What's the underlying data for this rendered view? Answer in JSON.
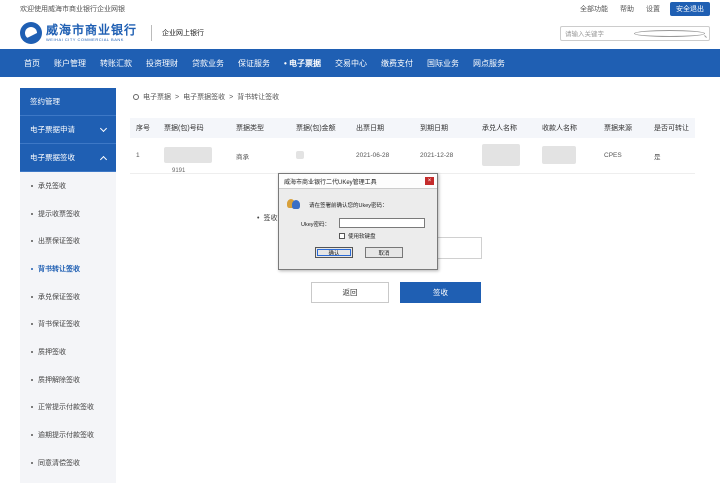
{
  "topbar": {
    "welcome": "欢迎使用威海市商业银行企业网银",
    "links": [
      "全部功能",
      "帮助",
      "设置"
    ],
    "exit_label": "安全退出"
  },
  "brand": {
    "name_cn": "威海市商业银行",
    "name_en": "WEIHAI CITY COMMERCIAL BANK",
    "sub": "企业网上银行",
    "search_placeholder": "请输入关键字"
  },
  "nav": {
    "items": [
      "首页",
      "账户管理",
      "转账汇款",
      "投资理财",
      "贷款业务",
      "保证服务",
      "• 电子票据",
      "交易中心",
      "缴费支付",
      "国际业务",
      "网点服务"
    ],
    "active_index": 6
  },
  "sidebar": {
    "heads": [
      "签约管理",
      "电子票据申请",
      "电子票据签收"
    ],
    "items": [
      "承兑签收",
      "提示收票签收",
      "出票保证签收",
      "背书转让签收",
      "承兑保证签收",
      "背书保证签收",
      "质押签收",
      "质押解除签收",
      "正常提示付款签收",
      "逾期提示付款签收",
      "同意清偿签收"
    ],
    "active_index": 3
  },
  "breadcrumb": {
    "items": [
      "电子票据",
      ">",
      "电子票据签收",
      ">",
      "背书转让签收"
    ]
  },
  "table": {
    "headers": [
      "序号",
      "票据(包)号码",
      "票据类型",
      "票据(包)金额",
      "出票日期",
      "到期日期",
      "承兑人名称",
      "收款人名称",
      "票据来源",
      "是否可转让"
    ],
    "rows": [
      {
        "seq": "1",
        "type": "商承",
        "issue_date": "2021-06-28",
        "due_date": "2021-12-28",
        "source": "CPES",
        "transferable": "是"
      }
    ],
    "hidden_number_tail": "9191"
  },
  "form": {
    "label_prefix": "•",
    "label": "签收"
  },
  "buttons": {
    "back": "返回",
    "sign": "签收"
  },
  "dialog": {
    "title": "威海市商业银行二代UKey管理工具",
    "close": "×",
    "prompt": "请在签署前确认您的Ukey密码：",
    "pw_label": "Ukey密码：",
    "checkbox_label": "使用软键盘",
    "ok": "确认",
    "cancel": "取消"
  }
}
